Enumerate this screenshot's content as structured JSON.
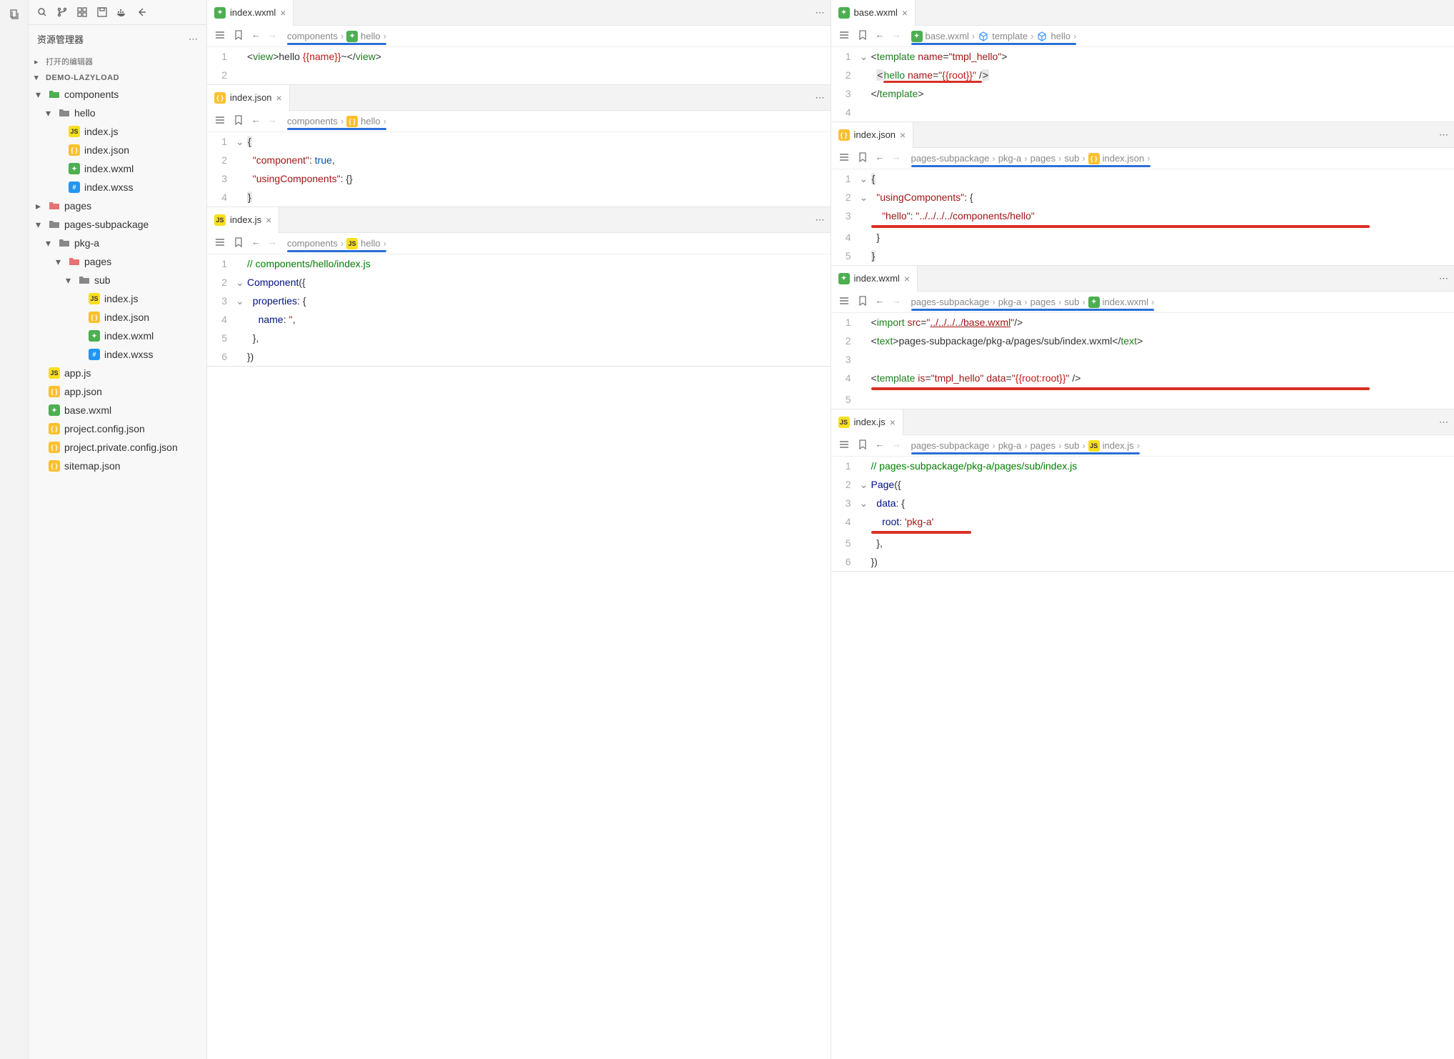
{
  "sidebar": {
    "title": "资源管理器",
    "sections": {
      "opened": "打开的编辑器",
      "project": "DEMO-LAZYLOAD"
    },
    "tree": [
      {
        "indent": 0,
        "chev": "▾",
        "icon": "folder",
        "label": "components",
        "color": "#4caf50"
      },
      {
        "indent": 1,
        "chev": "▾",
        "icon": "folder",
        "label": "hello",
        "color": "#888"
      },
      {
        "indent": 2,
        "chev": "",
        "icon": "js",
        "label": "index.js"
      },
      {
        "indent": 2,
        "chev": "",
        "icon": "json",
        "label": "index.json"
      },
      {
        "indent": 2,
        "chev": "",
        "icon": "wxml",
        "label": "index.wxml"
      },
      {
        "indent": 2,
        "chev": "",
        "icon": "wxss",
        "label": "index.wxss"
      },
      {
        "indent": 0,
        "chev": "▸",
        "icon": "folder",
        "label": "pages",
        "color": "#e57373"
      },
      {
        "indent": 0,
        "chev": "▾",
        "icon": "folder",
        "label": "pages-subpackage",
        "color": "#888"
      },
      {
        "indent": 1,
        "chev": "▾",
        "icon": "folder",
        "label": "pkg-a",
        "color": "#888"
      },
      {
        "indent": 2,
        "chev": "▾",
        "icon": "folder",
        "label": "pages",
        "color": "#e57373"
      },
      {
        "indent": 3,
        "chev": "▾",
        "icon": "folder",
        "label": "sub",
        "color": "#888"
      },
      {
        "indent": 4,
        "chev": "",
        "icon": "js",
        "label": "index.js"
      },
      {
        "indent": 4,
        "chev": "",
        "icon": "json",
        "label": "index.json"
      },
      {
        "indent": 4,
        "chev": "",
        "icon": "wxml",
        "label": "index.wxml"
      },
      {
        "indent": 4,
        "chev": "",
        "icon": "wxss",
        "label": "index.wxss"
      },
      {
        "indent": 0,
        "chev": "",
        "icon": "js",
        "label": "app.js"
      },
      {
        "indent": 0,
        "chev": "",
        "icon": "json",
        "label": "app.json"
      },
      {
        "indent": 0,
        "chev": "",
        "icon": "wxml",
        "label": "base.wxml"
      },
      {
        "indent": 0,
        "chev": "",
        "icon": "json",
        "label": "project.config.json"
      },
      {
        "indent": 0,
        "chev": "",
        "icon": "json",
        "label": "project.private.config.json"
      },
      {
        "indent": 0,
        "chev": "",
        "icon": "json",
        "label": "sitemap.json"
      }
    ]
  },
  "panes": {
    "leftCol": [
      {
        "tab": {
          "icon": "wxml",
          "name": "index.wxml"
        },
        "breadcrumb": [
          "components",
          "hello"
        ],
        "bcUnderline": true,
        "lines": [
          {
            "n": "1",
            "fold": "",
            "html": "<span class='tok-punct'>&lt;</span><span class='tok-tag'>view</span><span class='tok-punct'>&gt;</span>hello <span class='tok-var'>{{name}}</span>~<span class='tok-punct'>&lt;/</span><span class='tok-tag'>view</span><span class='tok-punct'>&gt;</span>"
          },
          {
            "n": "2",
            "fold": "",
            "html": ""
          }
        ]
      },
      {
        "tab": {
          "icon": "json",
          "name": "index.json"
        },
        "breadcrumb": [
          "components",
          "hello"
        ],
        "bcUnderline": true,
        "lines": [
          {
            "n": "1",
            "fold": "⌄",
            "html": "<span class='tok-bracket-hl'>{</span>"
          },
          {
            "n": "2",
            "fold": "",
            "html": "  <span class='tok-attr'>\"component\"</span>: <span class='tok-key'>true</span>,"
          },
          {
            "n": "3",
            "fold": "",
            "html": "  <span class='tok-attr'>\"usingComponents\"</span>: {}"
          },
          {
            "n": "4",
            "fold": "",
            "html": "<span class='tok-bracket-hl'>}</span>"
          }
        ]
      },
      {
        "tab": {
          "icon": "js",
          "name": "index.js"
        },
        "breadcrumb": [
          "components",
          "hello"
        ],
        "bcUnderline": true,
        "lines": [
          {
            "n": "1",
            "fold": "",
            "html": "<span class='tok-comment'>// components/hello/index.js</span>"
          },
          {
            "n": "2",
            "fold": "⌄",
            "html": "<span class='tok-prop'>Component</span>({"
          },
          {
            "n": "3",
            "fold": "⌄",
            "html": "  <span class='tok-prop'>properties</span>: {"
          },
          {
            "n": "4",
            "fold": "",
            "html": "    <span class='tok-prop'>name</span>: <span class='tok-string'>''</span>,"
          },
          {
            "n": "5",
            "fold": "",
            "html": "  },"
          },
          {
            "n": "6",
            "fold": "",
            "html": "})"
          }
        ]
      }
    ],
    "rightCol": [
      {
        "tab": {
          "icon": "wxml",
          "name": "base.wxml"
        },
        "breadcrumb": [
          "base.wxml",
          "template",
          "hello"
        ],
        "bcIcons": [
          "wxml",
          "cube",
          "cube"
        ],
        "bcUnderline": true,
        "lines": [
          {
            "n": "1",
            "fold": "⌄",
            "html": "<span class='tok-punct'>&lt;</span><span class='tok-tag'>template</span> <span class='tok-attr'>name</span>=<span class='tok-string'>\"tmpl_hello\"</span><span class='tok-punct'>&gt;</span>"
          },
          {
            "n": "2",
            "fold": "",
            "html": "  <span class='tok-bracket-hl'>&lt;</span><span class='underline-red-thin'><span class='tok-tag'>hello</span> <span class='tok-attr'>name</span>=<span class='tok-string'>\"</span><span class='tok-var'>{{root}}</span><span class='tok-string'>\"</span> /</span><span class='tok-bracket-hl'>&gt;</span>"
          },
          {
            "n": "3",
            "fold": "",
            "html": "<span class='tok-punct'>&lt;/</span><span class='tok-tag'>template</span><span class='tok-punct'>&gt;</span>"
          },
          {
            "n": "4",
            "fold": "",
            "html": ""
          }
        ]
      },
      {
        "tab": {
          "icon": "json",
          "name": "index.json"
        },
        "breadcrumb": [
          "pages-subpackage",
          "pkg-a",
          "pages",
          "sub",
          "index.json"
        ],
        "bcUnderline": true,
        "lines": [
          {
            "n": "1",
            "fold": "⌄",
            "html": "<span class='tok-bracket-hl'>{</span>"
          },
          {
            "n": "2",
            "fold": "⌄",
            "html": "  <span class='tok-attr'>\"usingComponents\"</span>: {"
          },
          {
            "n": "3",
            "fold": "",
            "html": "    <span class='tok-attr'>\"hello\"</span>: <span class='tok-string'>\"../../../../components/hello\"</span>",
            "redUnder": true
          },
          {
            "n": "4",
            "fold": "",
            "html": "  }"
          },
          {
            "n": "5",
            "fold": "",
            "html": "<span class='tok-bracket-hl'>}</span>"
          }
        ]
      },
      {
        "tab": {
          "icon": "wxml",
          "name": "index.wxml"
        },
        "breadcrumb": [
          "pages-subpackage",
          "pkg-a",
          "pages",
          "sub",
          "index.wxml"
        ],
        "bcUnderline": true,
        "lines": [
          {
            "n": "1",
            "fold": "",
            "html": "<span class='tok-punct'>&lt;</span><span class='tok-tag'>import</span> <span class='tok-attr'>src</span>=<span class='tok-string'>\"<u>../../../../base.wxml</u>\"</span><span class='tok-punct'>/&gt;</span>"
          },
          {
            "n": "2",
            "fold": "",
            "html": "<span class='tok-punct'>&lt;</span><span class='tok-tag'>text</span><span class='tok-punct'>&gt;</span>pages-subpackage/pkg-a/pages/sub/index.wxml<span class='tok-punct'>&lt;/</span><span class='tok-tag'>text</span><span class='tok-punct'>&gt;</span>"
          },
          {
            "n": "3",
            "fold": "",
            "html": ""
          },
          {
            "n": "4",
            "fold": "",
            "html": "<span class='tok-punct'>&lt;</span><span class='tok-tag'>template</span> <span class='tok-attr'>is</span>=<span class='tok-string'>\"tmpl_hello\"</span> <span class='tok-attr'>data</span>=<span class='tok-string'>\"</span><span class='tok-var'>{{root:root}}</span><span class='tok-string'>\"</span> <span class='tok-punct'>/&gt;</span>",
            "redUnder": true
          },
          {
            "n": "5",
            "fold": "",
            "html": ""
          }
        ]
      },
      {
        "tab": {
          "icon": "js",
          "name": "index.js"
        },
        "breadcrumb": [
          "pages-subpackage",
          "pkg-a",
          "pages",
          "sub",
          "index.js"
        ],
        "bcUnderline": true,
        "lines": [
          {
            "n": "1",
            "fold": "",
            "html": "<span class='tok-comment'>// pages-subpackage/pkg-a/pages/sub/index.js</span>"
          },
          {
            "n": "2",
            "fold": "⌄",
            "html": "<span class='tok-prop'>Page</span>({"
          },
          {
            "n": "3",
            "fold": "⌄",
            "html": "  <span class='tok-prop'>data</span>: {"
          },
          {
            "n": "4",
            "fold": "",
            "html": "    <span class='tok-prop'>root</span>: <span class='tok-string'>'pkg-a'</span>",
            "redUnder": true,
            "redShort": true
          },
          {
            "n": "5",
            "fold": "",
            "html": "  },"
          },
          {
            "n": "6",
            "fold": "",
            "html": "})"
          }
        ]
      }
    ]
  }
}
